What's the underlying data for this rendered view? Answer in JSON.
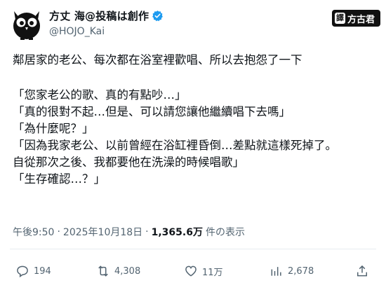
{
  "author": {
    "display_name": "方丈 海@投稿は創作",
    "handle": "@HOJO_Kai",
    "avatar_icon": "owl-avatar-icon",
    "verified_icon": "verified-badge-icon",
    "verified_color": "#1d9bf0"
  },
  "translator_badge": {
    "prefix": "譯",
    "name": "方古君"
  },
  "body": {
    "lines": [
      "鄰居家的老公、每次都在浴室裡歡唱、所以去抱怨了一下",
      "",
      "「您家老公的歌、真的有點吵…」",
      "「真的很對不起…但是、可以請您讓他繼續唱下去嗎」",
      "「為什麼呢？」",
      "「因為我家老公、以前曾經在浴缸裡昏倒…差點就這樣死掉了。",
      "自從那次之後、我都要他在洗澡的時候唱歌」",
      "「生存確認…？」"
    ]
  },
  "meta": {
    "time": "午後9:50",
    "separator": "·",
    "date": "2025年10月18日",
    "views_count": "1,365.6万",
    "views_label": "件の表示"
  },
  "actions": {
    "reply": {
      "icon": "reply-icon",
      "count": "194"
    },
    "repost": {
      "icon": "repost-icon",
      "count": "4,308"
    },
    "like": {
      "icon": "heart-icon",
      "count": "11万"
    },
    "bookmark": {
      "icon": "bookmark-icon",
      "count": "2,678"
    },
    "share": {
      "icon": "share-icon",
      "count": ""
    }
  },
  "colors": {
    "text": "#0f1419",
    "secondary_text": "#536471",
    "divider": "#e6ecf0"
  }
}
